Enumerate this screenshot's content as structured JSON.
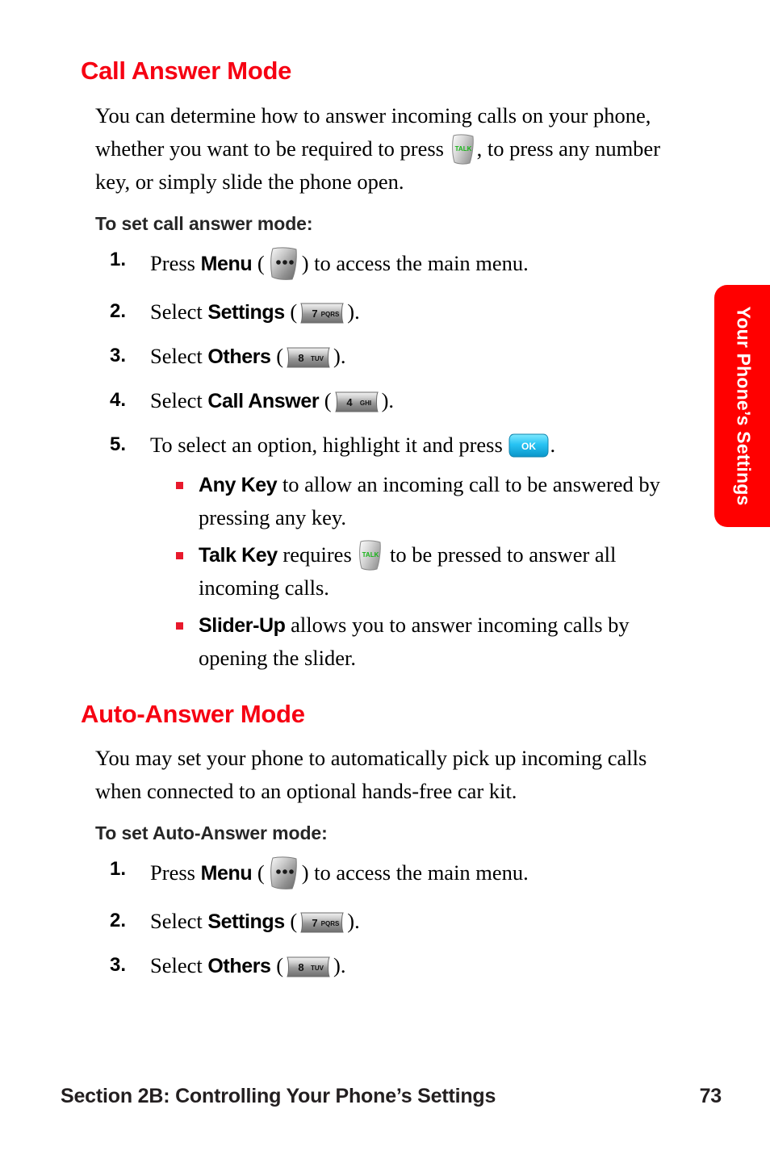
{
  "page": {
    "side_tab_label": "Your Phone’s Settings",
    "accent_red": "#f60012",
    "tab_red": "#ff0000",
    "bullet_red": "#e8192c"
  },
  "sections": [
    {
      "title": "Call Answer Mode",
      "paragraph_part1": "You can determine how to answer incoming calls on your phone, whether you want to be required to press",
      "paragraph_part2": ", to press any number key, or simply slide the phone open.",
      "sub_head": "To set call answer mode:",
      "steps": [
        {
          "num": "1.",
          "lead": "Press",
          "term": "Menu",
          "open_paren": "(",
          "icon": "menu-key-icon",
          "close_paren": ")",
          "tail": "to access the main menu."
        },
        {
          "num": "2.",
          "lead": "Select",
          "term": "Settings",
          "open_paren": "(",
          "icon": "key-7-pqrs-icon",
          "close_paren": ").",
          "tail": ""
        },
        {
          "num": "3.",
          "lead": "Select",
          "term": "Others",
          "open_paren": "(",
          "icon": "key-8-tuv-icon",
          "close_paren": ").",
          "tail": ""
        },
        {
          "num": "4.",
          "lead": "Select",
          "term": "Call Answer",
          "open_paren": "(",
          "icon": "key-4-ghi-icon",
          "close_paren": ").",
          "tail": ""
        },
        {
          "num": "5.",
          "lead": "To select an option, highlight it and press",
          "term": "",
          "open_paren": "",
          "icon": "ok-key-icon",
          "close_paren": ".",
          "tail": ""
        }
      ],
      "bullets": [
        {
          "term": "Any Key",
          "text_before_icon": "to allow an incoming call to be answered by pressing any key.",
          "icon": "",
          "text_after_icon": ""
        },
        {
          "term": "Talk Key",
          "text_before_icon": "requires",
          "icon": "talk-key-icon",
          "text_after_icon": "to be pressed to answer all incoming calls."
        },
        {
          "term": "Slider-Up",
          "text_before_icon": "allows you to answer incoming calls by opening the slider.",
          "icon": "",
          "text_after_icon": ""
        }
      ]
    },
    {
      "title": "Auto-Answer Mode",
      "paragraph_part1": "You may set your phone to automatically pick up incoming calls when connected to an optional hands-free car kit.",
      "paragraph_part2": "",
      "sub_head": "To set Auto-Answer mode:",
      "steps": [
        {
          "num": "1.",
          "lead": "Press",
          "term": "Menu",
          "open_paren": "(",
          "icon": "menu-key-icon",
          "close_paren": ")",
          "tail": "to access the main menu."
        },
        {
          "num": "2.",
          "lead": "Select",
          "term": "Settings",
          "open_paren": "(",
          "icon": "key-7-pqrs-icon",
          "close_paren": ").",
          "tail": ""
        },
        {
          "num": "3.",
          "lead": "Select",
          "term": "Others",
          "open_paren": "(",
          "icon": "key-8-tuv-icon",
          "close_paren": ").",
          "tail": ""
        }
      ],
      "bullets": []
    }
  ],
  "keys": {
    "key7": {
      "digit": "7",
      "letters": "PQRS"
    },
    "key8": {
      "digit": "8",
      "letters": "TUV"
    },
    "key4": {
      "digit": "4",
      "letters": "GHI"
    },
    "talk": {
      "label": "TALK"
    },
    "ok": {
      "label": "OK"
    }
  },
  "footer": {
    "section_text": "Section 2B: Controlling Your Phone’s Settings",
    "page_number": "73"
  }
}
